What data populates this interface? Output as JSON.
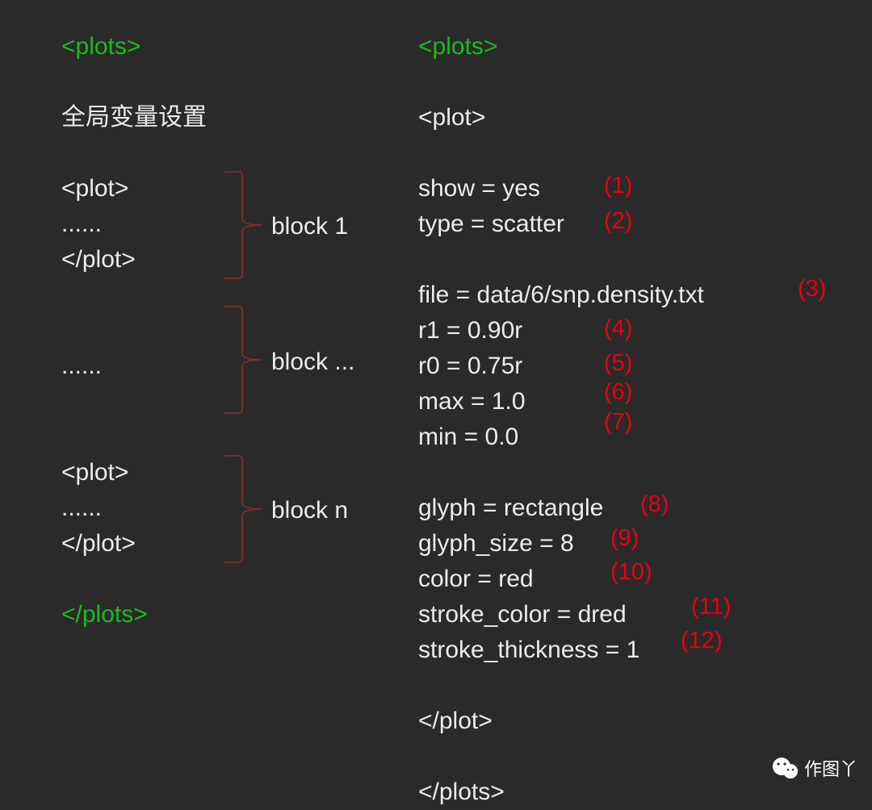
{
  "left": {
    "plots_open": "<plots>",
    "global_settings": "全局变量设置",
    "plot_open": "<plot>",
    "dots": "......",
    "plot_close": "</plot>",
    "plots_close": "</plots>",
    "block1": "block 1",
    "block_mid": "block ...",
    "blockn": "block n"
  },
  "right": {
    "plots_open": "<plots>",
    "plot_open": "<plot>",
    "l_show": "show  = yes",
    "l_type": "type  = scatter",
    "l_file": "file  = data/6/snp.density.txt",
    "l_r1": "r1     = 0.90r",
    "l_r0": "r0     = 0.75r",
    "l_max": "max   = 1.0",
    "l_min": "min    = 0.0",
    "l_glyph": "glyph = rectangle",
    "l_gsize": "glyph_size = 8",
    "l_color": "color  =  red",
    "l_scol": "stroke_color  = dred",
    "l_sthk": "stroke_thickness  = 1",
    "plot_close": "</plot>",
    "plots_close": "</plots>",
    "a1": "(1)",
    "a2": "(2)",
    "a3": "(3)",
    "a4": "(4)",
    "a5": "(5)",
    "a6": "(6)",
    "a7": "(7)",
    "a8": "(8)",
    "a9": "(9)",
    "a10": "(10)",
    "a11": "(11)",
    "a12": "(12)"
  },
  "watermark": "作图丫"
}
